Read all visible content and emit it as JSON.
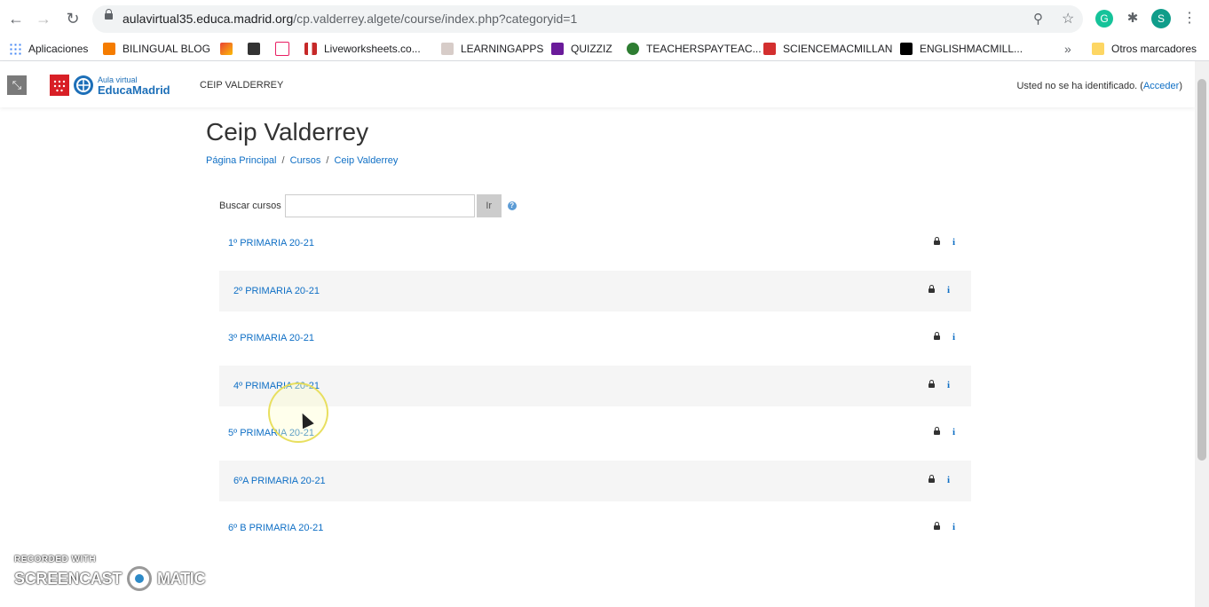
{
  "browser": {
    "url_domain": "aulavirtual35.educa.madrid.org",
    "url_path": "/cp.valderrey.algete/course/index.php?categoryid=1",
    "profile_initial": "S",
    "bookmarks": [
      {
        "label": "Aplicaciones",
        "color": "#4285f4"
      },
      {
        "label": "BILINGUAL BLOG",
        "color": "#f57c00"
      },
      {
        "label": "",
        "color": "#ea4335"
      },
      {
        "label": "",
        "color": "#333333"
      },
      {
        "label": "",
        "color": "#e91e63"
      },
      {
        "label": "Liveworksheets.co...",
        "color": "#c62828"
      },
      {
        "label": "LEARNINGAPPS",
        "color": "#8d6e63"
      },
      {
        "label": "QUIZZIZ",
        "color": "#6a1b9a"
      },
      {
        "label": "TEACHERSPAYTEAC...",
        "color": "#2e7d32"
      },
      {
        "label": "SCIENCEMACMILLAN",
        "color": "#d32f2f"
      },
      {
        "label": "ENGLISHMACMILL...",
        "color": "#000000"
      }
    ],
    "more_bookmarks": "»",
    "other_bookmarks": "Otros marcadores"
  },
  "header": {
    "logo_line1": "Aula virtual",
    "logo_line2": "EducaMadrid",
    "site_name": "CEIP VALDERREY",
    "login_text": "Usted no se ha identificado. (",
    "login_link": "Acceder",
    "login_close": ")"
  },
  "page": {
    "title": "Ceip Valderrey",
    "breadcrumb": [
      "Página Principal",
      "Cursos",
      "Ceip Valderrey"
    ],
    "breadcrumb_sep": "/",
    "search_label": "Buscar cursos",
    "search_button": "Ir",
    "help": "?"
  },
  "courses": [
    "1º PRIMARIA 20-21",
    "2º PRIMARIA 20-21",
    "3º PRIMARIA 20-21",
    "4º PRIMARIA 20-21",
    "5º PRIMARIA 20-21",
    "6ºA PRIMARIA 20-21",
    "6º B PRIMARIA 20-21"
  ],
  "course_info_icon": "i",
  "watermark": {
    "line1": "RECORDED WITH",
    "left": "SCREENCAST",
    "right": "MATIC"
  }
}
